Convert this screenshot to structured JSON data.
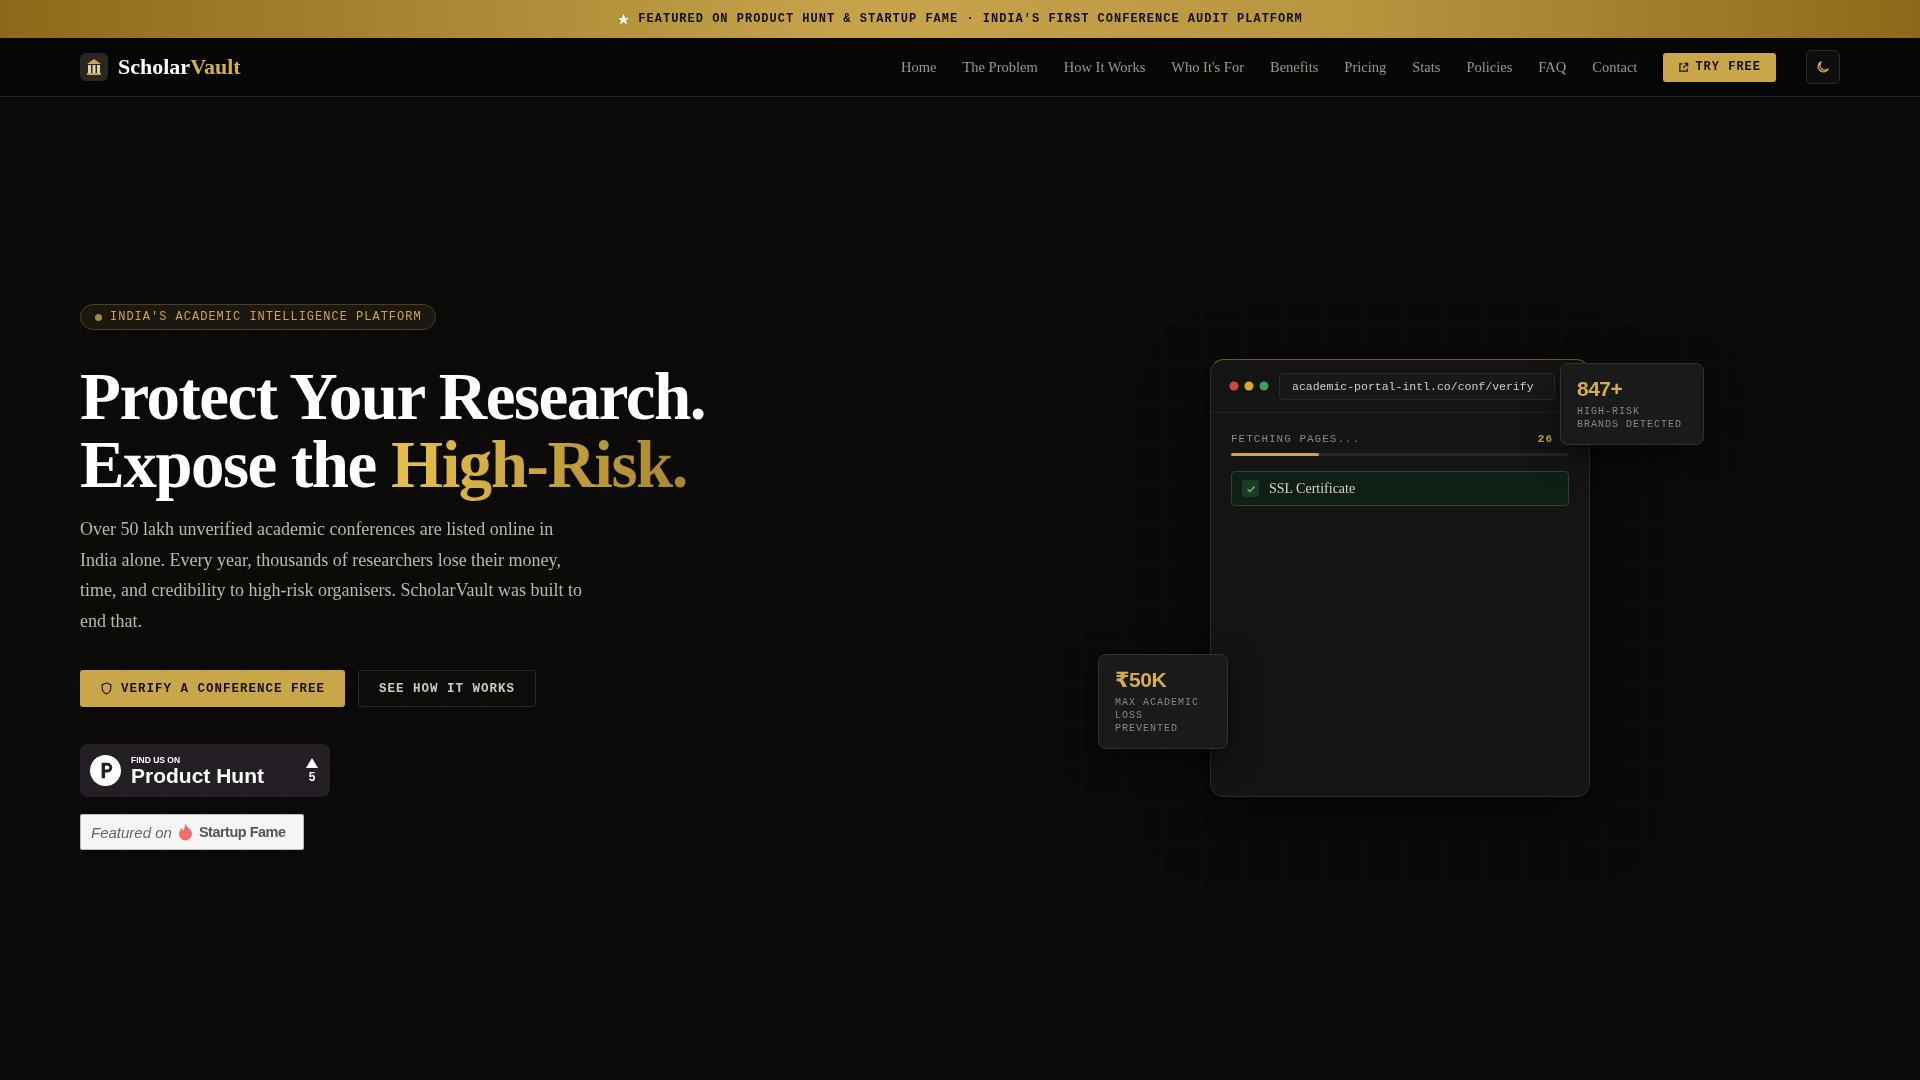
{
  "banner": {
    "text": "FEATURED ON PRODUCT HUNT & STARTUP FAME · INDIA'S FIRST CONFERENCE AUDIT PLATFORM"
  },
  "nav": {
    "logo": {
      "first": "Scholar",
      "second": "Vault"
    },
    "links": [
      "Home",
      "The Problem",
      "How It Works",
      "Who It's For",
      "Benefits",
      "Pricing",
      "Stats",
      "Policies",
      "FAQ",
      "Contact"
    ],
    "cta": "TRY FREE"
  },
  "hero": {
    "badge": "INDIA'S ACADEMIC INTELLIGENCE PLATFORM",
    "headline": {
      "line_1": "Protect Your Research.",
      "line_2": "Expose the ",
      "highlight": "High-Risk."
    },
    "description": "Over 50 lakh unverified academic conferences are listed online in India alone. Every year, thousands of researchers lose their money, time, and credibility to high-risk organisers. ScholarVault was built to end that.",
    "buttons": [
      {
        "label": "VERIFY A CONFERENCE FREE",
        "kind": "primary"
      },
      {
        "label": "SEE HOW IT WORKS",
        "kind": "secondary"
      }
    ],
    "product_hunt": {
      "caption": "FIND US ON",
      "name": "Product Hunt",
      "votes": "5"
    },
    "startup_fame": {
      "prefix": "Featured on",
      "name": "Startup Fame"
    }
  },
  "mockup": {
    "url": "academic-portal-intl.co/conf/verify",
    "progress": {
      "label": "FETCHING PAGES...",
      "reading": "26",
      "level": 0.26
    },
    "checks": [
      {
        "label": "SSL Certificate",
        "checked": true
      }
    ],
    "stats": [
      {
        "value": "847+",
        "label": "HIGH-RISK BRANDS DETECTED"
      },
      {
        "value": "₹50K",
        "label": "MAX ACADEMIC LOSS PREVENTED"
      }
    ]
  }
}
